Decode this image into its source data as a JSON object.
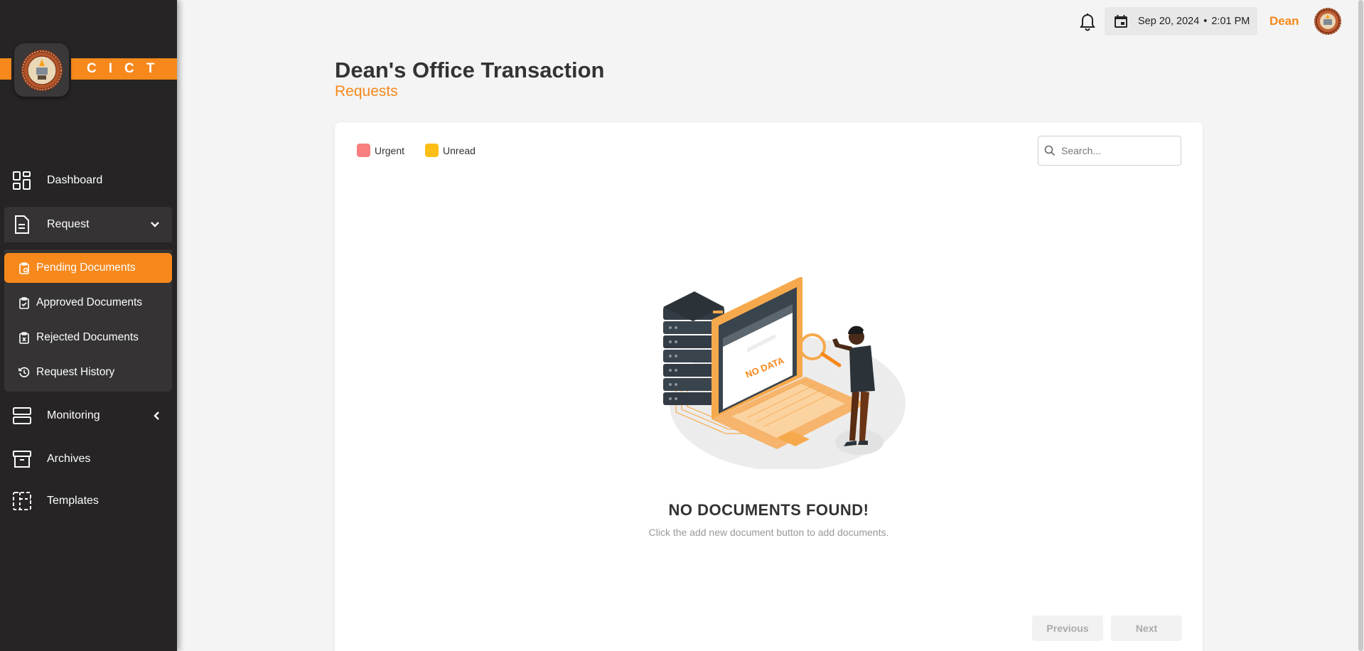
{
  "brand": {
    "text": "CICT"
  },
  "sidebar": {
    "items": [
      {
        "label": "Dashboard",
        "icon": "dashboard-icon"
      },
      {
        "label": "Request",
        "icon": "document-icon"
      },
      {
        "label": "Monitoring",
        "icon": "monitoring-icon"
      },
      {
        "label": "Archives",
        "icon": "archive-icon"
      },
      {
        "label": "Templates",
        "icon": "templates-icon"
      }
    ],
    "request_sub": [
      {
        "label": "Pending Documents",
        "icon": "clipboard-clock-icon",
        "active": true
      },
      {
        "label": "Approved Documents",
        "icon": "clipboard-check-icon"
      },
      {
        "label": "Rejected Documents",
        "icon": "clipboard-x-icon"
      },
      {
        "label": "Request History",
        "icon": "history-icon"
      }
    ]
  },
  "header": {
    "date": "Sep 20, 2024",
    "time": "2:01 PM",
    "separator": "•",
    "user": "Dean"
  },
  "page": {
    "title": "Dean's Office Transaction",
    "subtitle": "Requests"
  },
  "legend": [
    {
      "label": "Urgent",
      "color": "#f77f7f"
    },
    {
      "label": "Unread",
      "color": "#fdbf15"
    }
  ],
  "search": {
    "placeholder": "Search..."
  },
  "empty_state": {
    "title": "NO DOCUMENTS FOUND!",
    "subtitle": "Click the add new document button to add documents.",
    "illustration_text": "NO DATA"
  },
  "pagination": {
    "previous": "Previous",
    "next": "Next"
  },
  "colors": {
    "accent": "#f6881c",
    "sidebar": "#262424"
  }
}
